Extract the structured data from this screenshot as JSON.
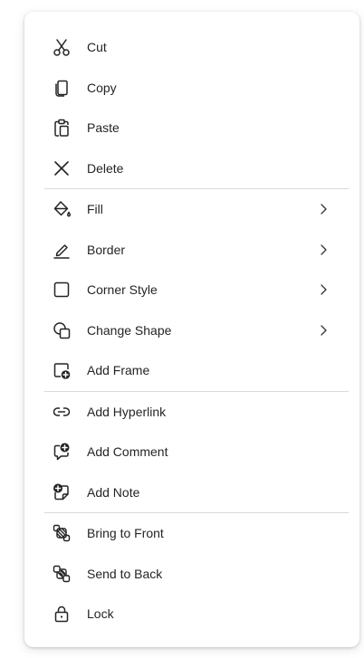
{
  "menu": {
    "groups": [
      {
        "items": [
          {
            "label": "Cut",
            "icon": "scissors-icon",
            "submenu": false
          },
          {
            "label": "Copy",
            "icon": "copy-icon",
            "submenu": false
          },
          {
            "label": "Paste",
            "icon": "paste-icon",
            "submenu": false
          },
          {
            "label": "Delete",
            "icon": "delete-icon",
            "submenu": false
          }
        ]
      },
      {
        "items": [
          {
            "label": "Fill",
            "icon": "paint-bucket-icon",
            "submenu": true
          },
          {
            "label": "Border",
            "icon": "pen-icon",
            "submenu": true
          },
          {
            "label": "Corner Style",
            "icon": "square-corner-icon",
            "submenu": true
          },
          {
            "label": "Change Shape",
            "icon": "change-shape-icon",
            "submenu": true
          },
          {
            "label": "Add Frame",
            "icon": "add-frame-icon",
            "submenu": false
          }
        ]
      },
      {
        "items": [
          {
            "label": "Add Hyperlink",
            "icon": "link-icon",
            "submenu": false
          },
          {
            "label": "Add Comment",
            "icon": "add-comment-icon",
            "submenu": false
          },
          {
            "label": "Add Note",
            "icon": "add-note-icon",
            "submenu": false
          }
        ]
      },
      {
        "items": [
          {
            "label": "Bring to Front",
            "icon": "bring-to-front-icon",
            "submenu": false
          },
          {
            "label": "Send to Back",
            "icon": "send-to-back-icon",
            "submenu": false
          },
          {
            "label": "Lock",
            "icon": "lock-icon",
            "submenu": false
          }
        ]
      }
    ]
  },
  "colors": {
    "text": "#242424",
    "icon": "#242424",
    "divider": "#dadada",
    "background": "#ffffff"
  }
}
